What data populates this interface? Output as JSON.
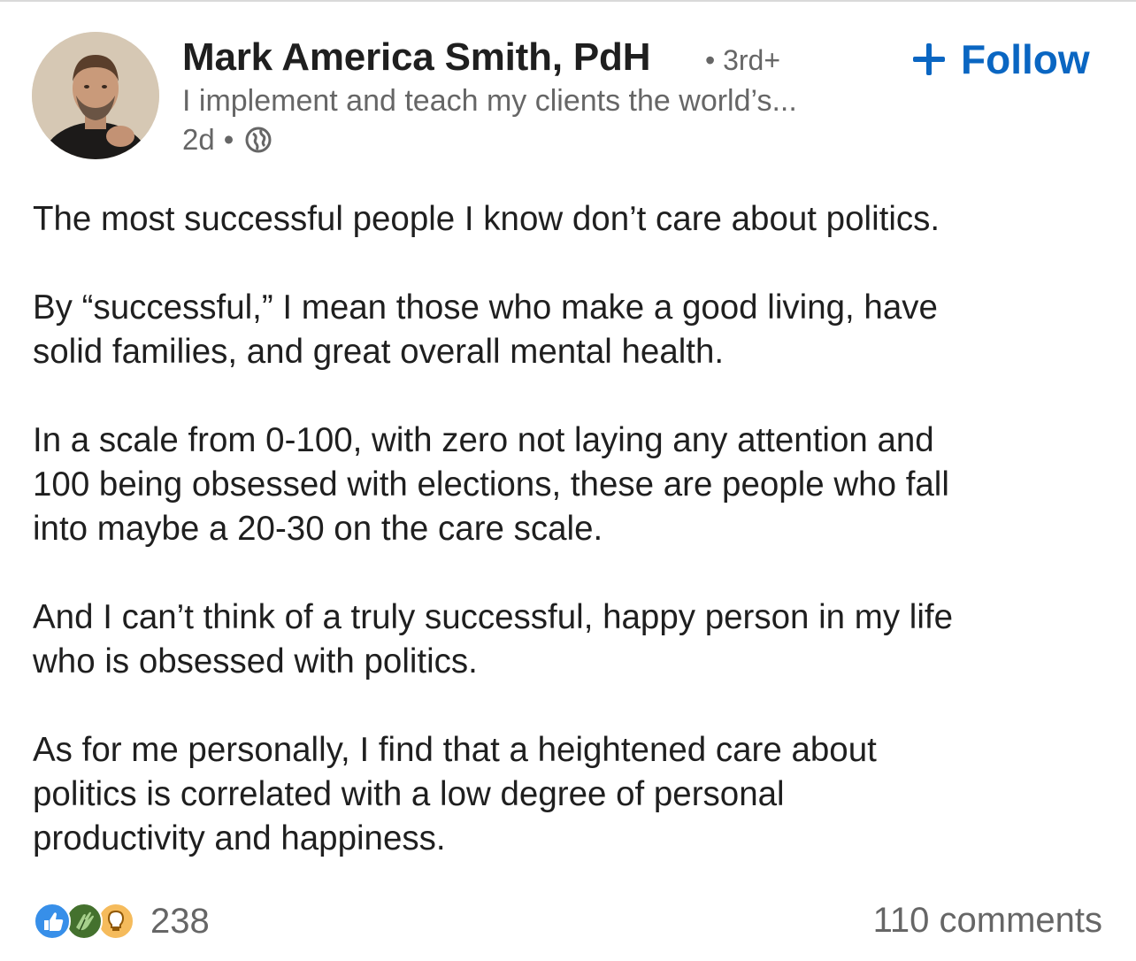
{
  "post": {
    "author": {
      "name": "Mark America Smith, PdH",
      "degree": "• 3rd+",
      "headline": "I implement and teach my clients the world’s...",
      "time": "2d",
      "separator": "•",
      "visibility_icon": "globe-icon"
    },
    "follow_label": "Follow",
    "paragraphs": [
      "The most successful people I know don’t care about politics.",
      "By “successful,” I mean those who make a good living, have\nsolid families, and great overall mental health.",
      "In a scale from 0-100, with zero not laying any attention and\n100 being obsessed with elections, these are people who fall\ninto maybe a 20-30 on the care scale.",
      "And I can’t think of a truly successful, happy  person in my life\nwho is obsessed with politics.",
      "As for me personally, I find that a heightened care about\npolitics is correlated with a low degree of personal\nproductivity and happiness."
    ],
    "reactions": {
      "icons": [
        "like-icon",
        "celebrate-icon",
        "insightful-icon"
      ],
      "count": "238"
    },
    "comments": "110 comments"
  },
  "colors": {
    "accent": "#0a66c2",
    "text": "#1f1f1f",
    "muted": "#666666",
    "like": "#378fe9",
    "celebrate": "#44712e",
    "insightful": "#f5bb5c"
  }
}
